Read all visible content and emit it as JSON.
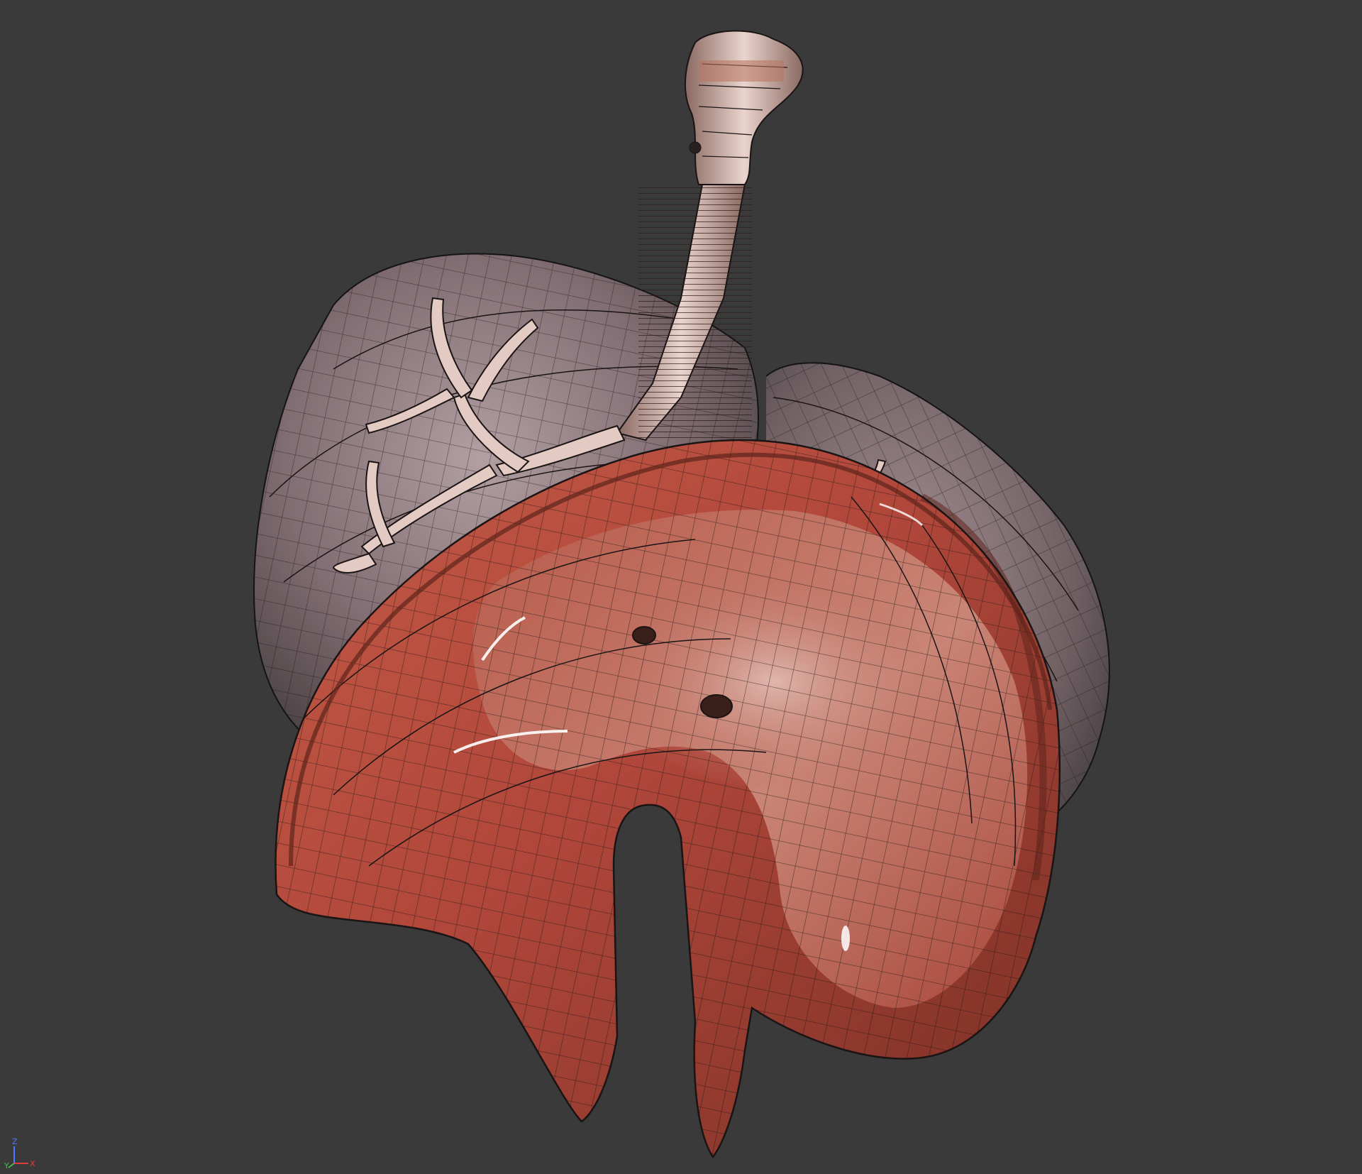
{
  "viewport": {
    "background": "#3a3a3a",
    "axis_gizmo": {
      "z_label": "Z",
      "y_label": "Y",
      "x_label": "X",
      "colors": {
        "z": "#4a7cff",
        "y": "#3cc04a",
        "x": "#e23a3a"
      }
    }
  },
  "model": {
    "icons": [
      "diaphragm-mesh",
      "lungs-wireframe",
      "trachea-mesh",
      "bronchi-mesh"
    ],
    "colors": {
      "diaphragm": "#b24a3a",
      "diaphragm_light": "#d8735e",
      "diaphragm_dark": "#6e2a20",
      "center_tendon": "#d9b0a8",
      "lung": "#b8a0a6",
      "trachea": "#e7cfc8",
      "wire": "#141414"
    }
  }
}
